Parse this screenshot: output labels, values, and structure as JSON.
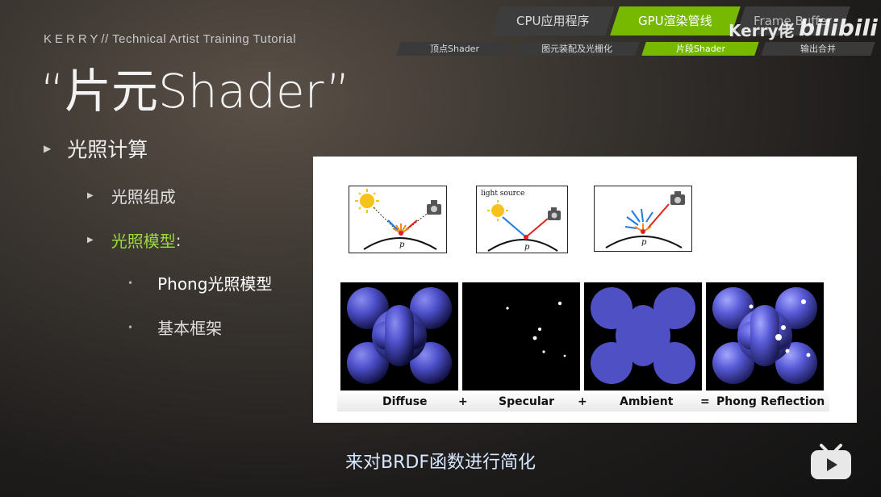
{
  "header": {
    "brand": "KERRY",
    "brand_sep": "//",
    "tutorial": "Technical Artist Training Tutorial",
    "slide_title": "“片元Shader”"
  },
  "pipeline": {
    "main_tabs": [
      {
        "label": "CPU应用程序",
        "active": false
      },
      {
        "label": "GPU渲染管线",
        "active": true
      },
      {
        "label": "Frame Buffer",
        "active": false
      }
    ],
    "sub_tabs": [
      {
        "label": "顶点Shader",
        "active": false
      },
      {
        "label": "图元装配及光栅化",
        "active": false
      },
      {
        "label": "片段Shader",
        "active": true
      },
      {
        "label": "输出合并",
        "active": false
      }
    ]
  },
  "watermark": {
    "author": "Kerry佬",
    "site": "bilibili"
  },
  "outline": {
    "level1": "光照计算",
    "level2": [
      "光照组成",
      "光照模型"
    ],
    "level2_suffix": ":",
    "level3": [
      "Phong光照模型",
      "基本框架"
    ]
  },
  "figure": {
    "diagram_caption": "light source",
    "point_label": "p",
    "render_labels": [
      "Diffuse",
      "+",
      "Specular",
      "+",
      "Ambient",
      "=",
      "Phong Reflection"
    ]
  },
  "subtitle": "来对BRDF函数进行简化",
  "colors": {
    "accent_green": "#76b900",
    "highlight_text": "#9bdc3a",
    "subtitle_text": "#d8e8ff"
  }
}
